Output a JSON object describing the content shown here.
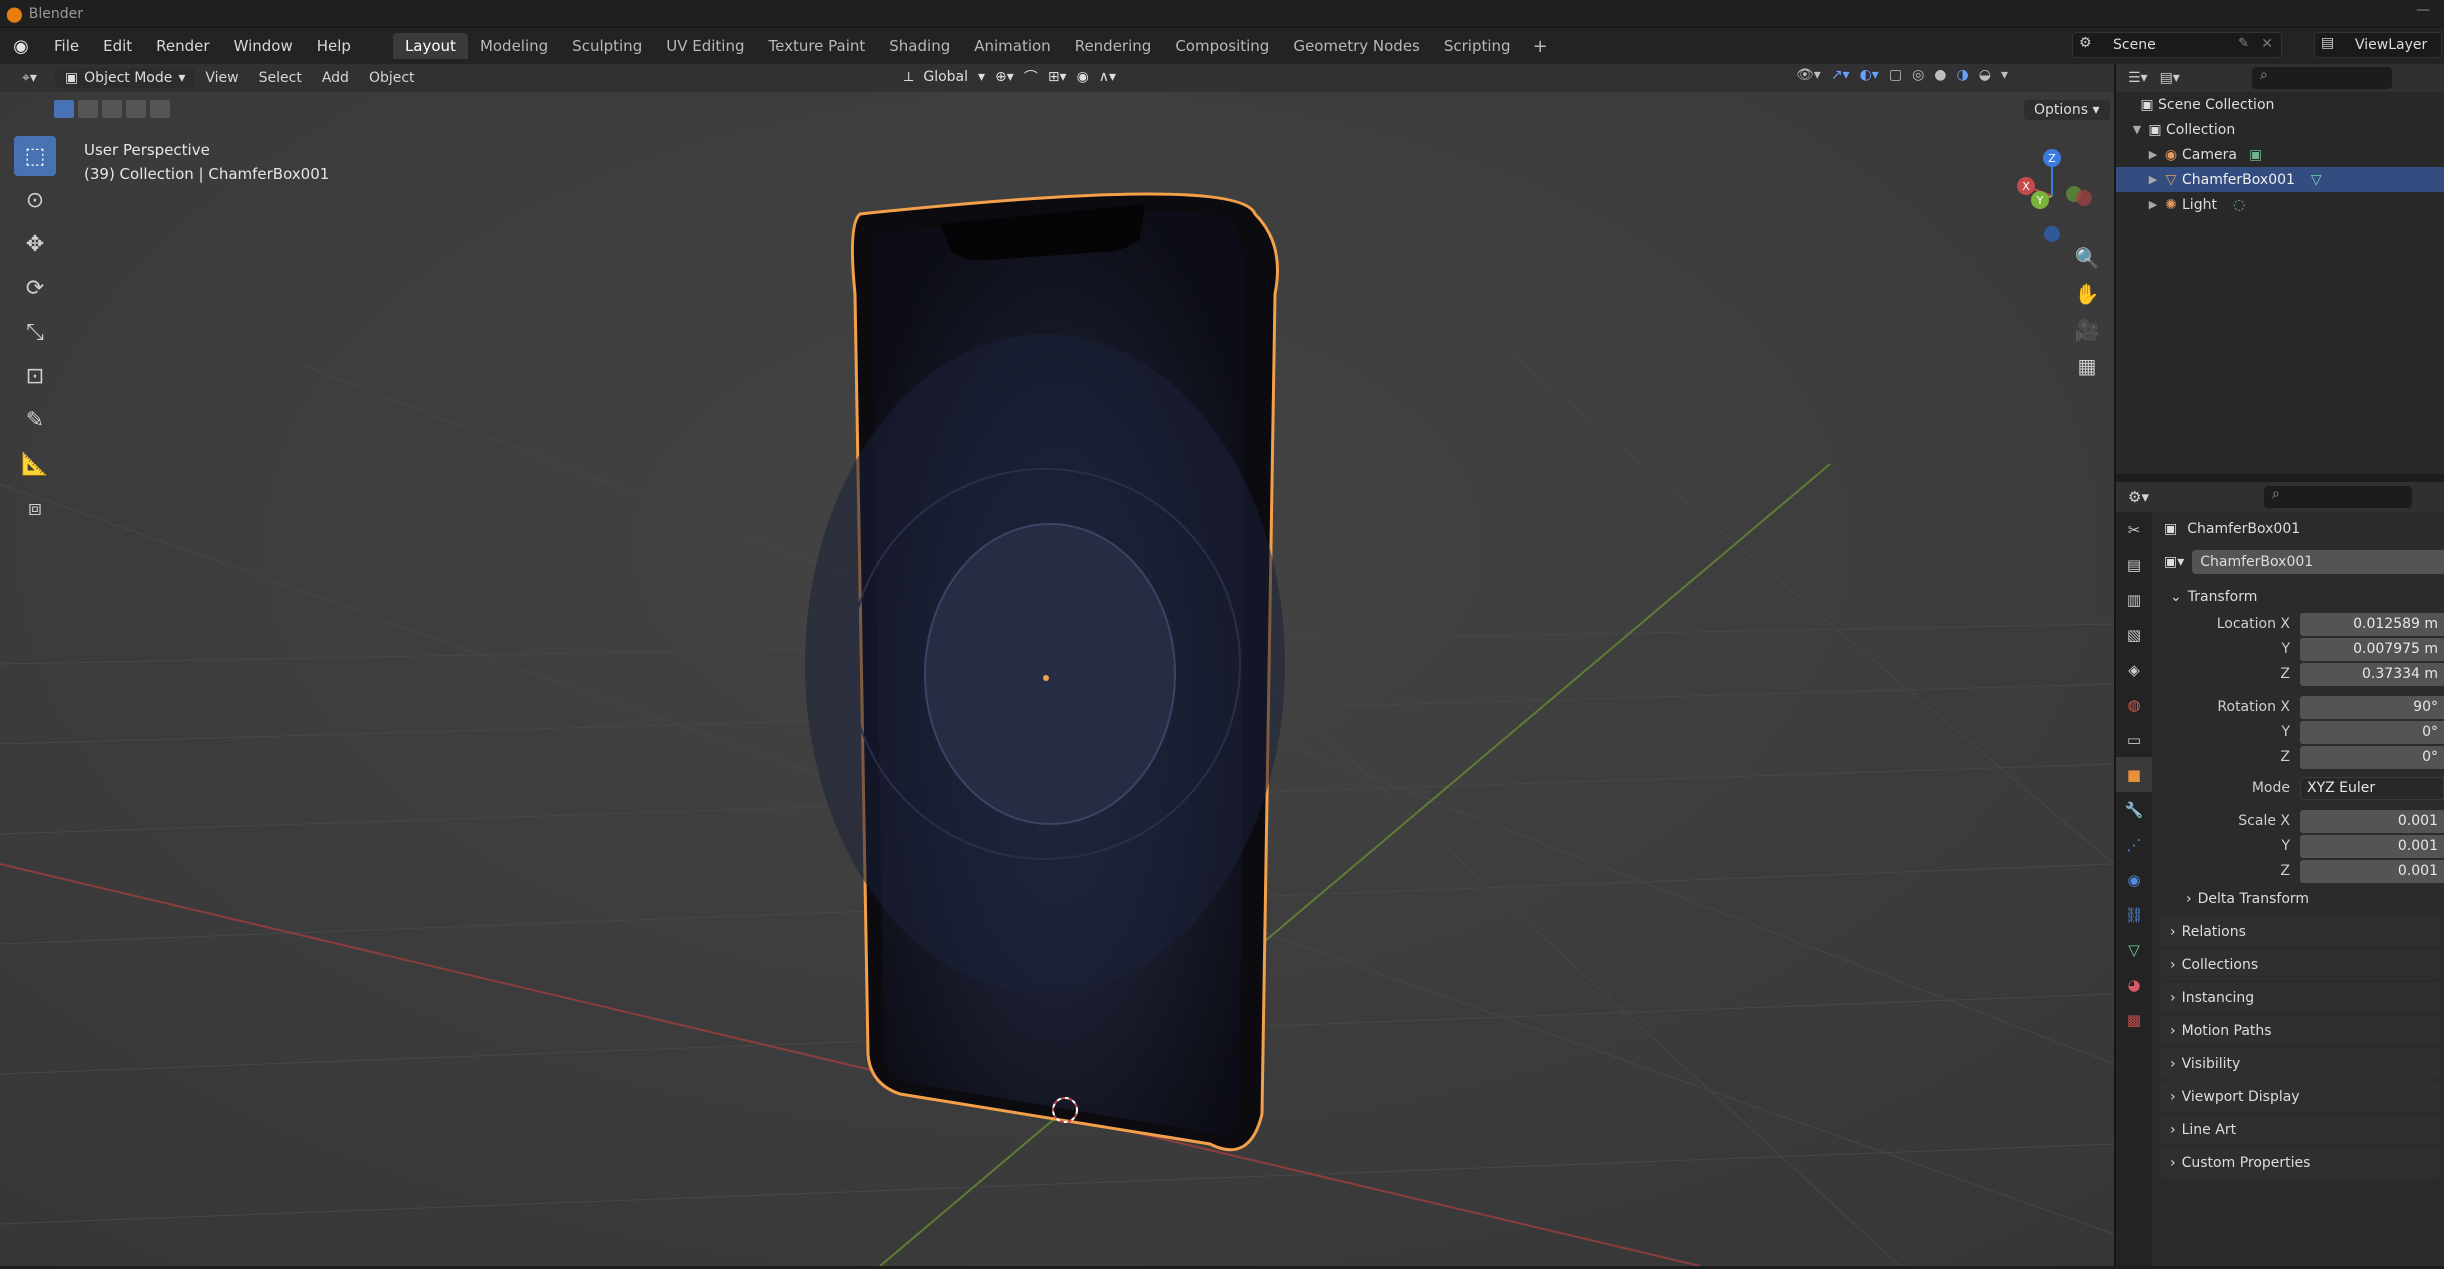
{
  "title_bar": {
    "app": "Blender"
  },
  "menu": [
    "File",
    "Edit",
    "Render",
    "Window",
    "Help"
  ],
  "workspaces": [
    "Layout",
    "Modeling",
    "Sculpting",
    "UV Editing",
    "Texture Paint",
    "Shading",
    "Animation",
    "Rendering",
    "Compositing",
    "Geometry Nodes",
    "Scripting"
  ],
  "active_workspace": "Layout",
  "scene": {
    "name": "Scene",
    "view_layer": "ViewLayer"
  },
  "viewport_header": {
    "mode": "Object Mode",
    "menus": [
      "View",
      "Select",
      "Add",
      "Object"
    ],
    "orientation": "Global",
    "options": "Options"
  },
  "viewport_overlay": {
    "perspective": "User Perspective",
    "collection_info": "(39) Collection | ChamferBox001"
  },
  "gizmo_axes": [
    "X",
    "Y",
    "Z"
  ],
  "outliner": {
    "root": "Scene Collection",
    "collection": "Collection",
    "items": [
      {
        "label": "Camera",
        "icon": "camera-icon",
        "selected": false
      },
      {
        "label": "ChamferBox001",
        "icon": "mesh-icon",
        "selected": true
      },
      {
        "label": "Light",
        "icon": "light-icon",
        "selected": false
      }
    ]
  },
  "properties": {
    "object_name": "ChamferBox001",
    "data_name": "ChamferBox001",
    "transform_label": "Transform",
    "location": {
      "label": "Location X",
      "x": "0.012589 m",
      "y": "0.007975 m",
      "z": "0.37334 m"
    },
    "rotation": {
      "label": "Rotation X",
      "x": "90°",
      "y": "0°",
      "z": "0°"
    },
    "mode": {
      "label": "Mode",
      "value": "XYZ Euler"
    },
    "scale": {
      "label": "Scale X",
      "x": "0.001",
      "y": "0.001",
      "z": "0.001"
    },
    "axis_labels": {
      "y": "Y",
      "z": "Z"
    },
    "delta_transform": "Delta Transform",
    "panels": [
      "Relations",
      "Collections",
      "Instancing",
      "Motion Paths",
      "Visibility",
      "Viewport Display",
      "Line Art",
      "Custom Properties"
    ]
  },
  "colors": {
    "accent_blue": "#4772b3",
    "selection_orange": "#f4a04a",
    "x_axis_red": "#c44b4b",
    "y_axis_green": "#7bb33a",
    "z_axis_blue": "#3d7ae0"
  }
}
